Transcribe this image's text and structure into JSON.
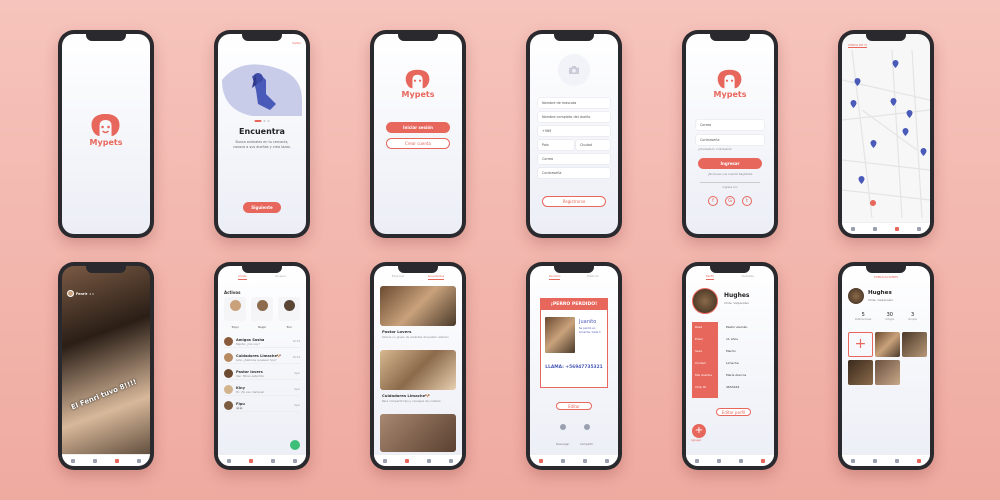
{
  "colors": {
    "accent": "#e8675c",
    "background": "#f3b6ad",
    "frame": "#2a2a2e"
  },
  "app": {
    "name": "Mypets"
  },
  "onboarding": {
    "title": "Encuentra",
    "text": "Busca animales en tu cercanía, conoce a sus dueños y crea lazos.",
    "next": "Siguiente",
    "skip": "Saltar"
  },
  "welcome": {
    "login": "Iniciar sesión",
    "create": "Crear cuenta"
  },
  "register": {
    "fields": [
      "Nombre de mascota",
      "Nombre completo del dueño",
      "+569",
      "País",
      "Ciudad",
      "Correo",
      "Contraseña"
    ],
    "submit": "Registrarse"
  },
  "login": {
    "email": "Correo",
    "password": "Contraseña",
    "forgot": "¿Olvidaste tu contraseña?",
    "submit": "Ingresar",
    "noaccount": "¿No tienes una cuenta? Regístrate",
    "with": "Ingresa con",
    "social": [
      "f",
      "G",
      "t"
    ]
  },
  "map": {
    "tab": "CERCA DE TI"
  },
  "story": {
    "user": "Fenrir",
    "time": "2 h",
    "caption": "El Fenri tuvo 8!!!!"
  },
  "chat": {
    "tabs": [
      "Chats",
      "Grupos"
    ],
    "active_title": "Activos",
    "active": [
      "Toppi",
      "Nappi",
      "Toxi"
    ],
    "items": [
      {
        "name": "Amigos Sasha",
        "msg": "Pepita: ¿me voy?",
        "time": "10:33"
      },
      {
        "name": "Cuidadores Limache🐶",
        "msg": "Lola: ¿Salimos a pasear hoy?",
        "time": "10:19"
      },
      {
        "name": "Pastor lovers",
        "msg": "Ven: Miren esta foto",
        "time": "Ayer"
      },
      {
        "name": "Kiny",
        "msg": "Tú: ¡Te veo mañana!",
        "time": "Ayer"
      },
      {
        "name": "Fipu",
        "msg": "😂😂",
        "time": "Ayer"
      }
    ]
  },
  "groups": {
    "tabs": [
      "Explorar",
      "Guardados"
    ],
    "cards": [
      {
        "title": "Pastor Lovers",
        "text": "Somos un grupo de amantes del pastor alemán"
      },
      {
        "title": "Cuidadores Limache🐶",
        "text": "Para compartir tips y consejos de cuidado"
      }
    ]
  },
  "lost": {
    "tabs": [
      "Perdido",
      "Publicar"
    ],
    "title": "¡PERRO PERDIDO!",
    "name": "Juanito",
    "details": "Se perdió en Limache, Calle 3",
    "call": "LLAMA: +56947735321",
    "edit": "Editar",
    "actions": [
      "Descargar",
      "Compartir"
    ]
  },
  "profile": {
    "tabs": [
      "Perfil",
      "Detalles"
    ],
    "name": "Hughes",
    "location": "Chile, Valparaíso",
    "fields": [
      {
        "k": "Raza",
        "v": "Pastor alemán"
      },
      {
        "k": "Edad",
        "v": "11 años"
      },
      {
        "k": "Sexo",
        "v": "Macho"
      },
      {
        "k": "Ciudad",
        "v": "Limache"
      },
      {
        "k": "Mis dueños",
        "v": "María Alarcos"
      },
      {
        "k": "Chip ID",
        "v": "4654164"
      }
    ],
    "edit": "Editar perfil",
    "add": "Agregar"
  },
  "gallery": {
    "tab": "PUBLICACIONES",
    "name": "Hughes",
    "location": "Chile, Valparaíso",
    "stats": [
      {
        "n": "5",
        "l": "Publicaciones"
      },
      {
        "n": "30",
        "l": "Amigos"
      },
      {
        "n": "3",
        "l": "Grupos"
      }
    ]
  }
}
